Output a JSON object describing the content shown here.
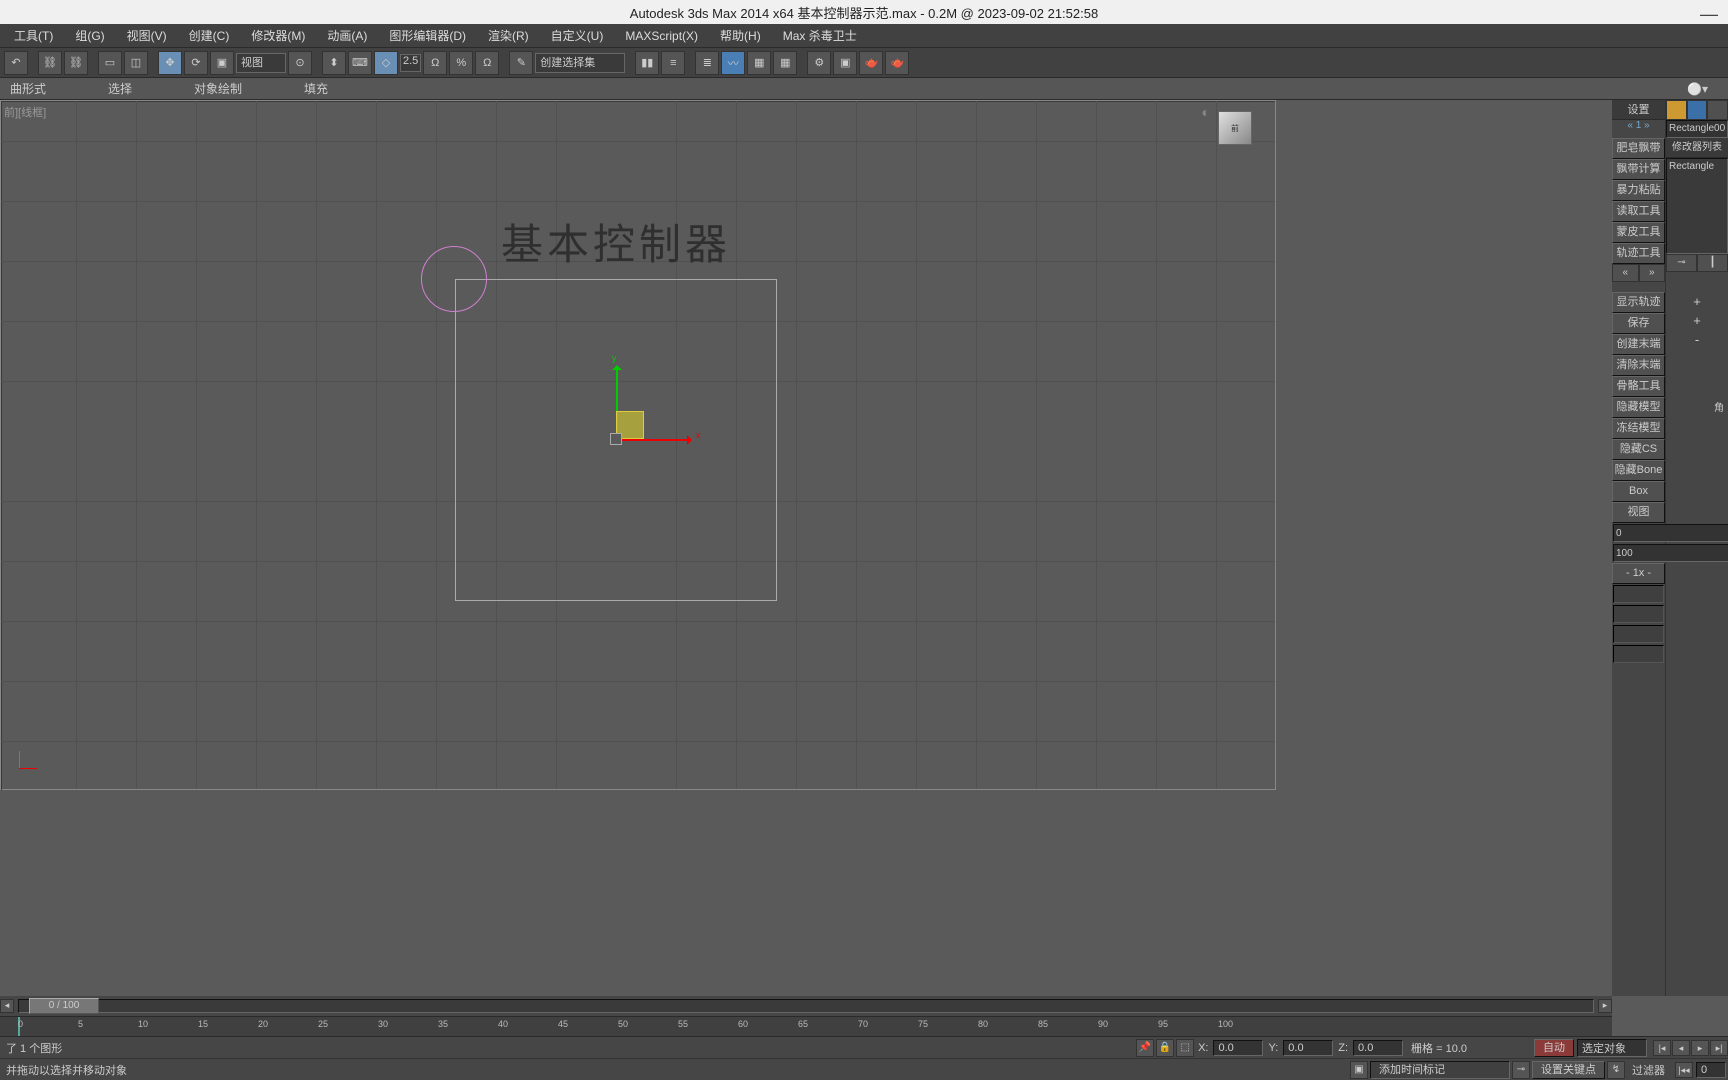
{
  "titlebar": {
    "text": "Autodesk 3ds Max  2014 x64      基本控制器示范.max - 0.2M @ 2023-09-02 21:52:58"
  },
  "menu": {
    "items": [
      "工具(T)",
      "组(G)",
      "视图(V)",
      "创建(C)",
      "修改器(M)",
      "动画(A)",
      "图形编辑器(D)",
      "渲染(R)",
      "自定义(U)",
      "MAXScript(X)",
      "帮助(H)",
      "Max 杀毒卫士"
    ]
  },
  "toolbar": {
    "view_dd": "视图",
    "spin_val": "2.5",
    "selset_dd": "创建选择集"
  },
  "ribbon": {
    "tabs": [
      "曲形式",
      "选择",
      "对象绘制",
      "填充"
    ]
  },
  "viewport": {
    "label": "前][线框]",
    "title_text": "基本控制器",
    "gizmo": {
      "x": "x",
      "y": "y"
    },
    "viewcube": "前"
  },
  "rightpanel": {
    "header1": "设置",
    "object_name": "Rectangle00",
    "link_label": "« 1 »",
    "mod_header": "修改器列表",
    "stack_item": "Rectangle",
    "col1_buttons": [
      "肥皂飘带",
      "飘带计算",
      "暴力粘贴",
      "读取工具",
      "蒙皮工具",
      "轨迹工具"
    ],
    "nav_prev": "«",
    "nav_next": "»",
    "col1_buttons2": [
      "显示轨迹",
      "保存",
      "创建末端",
      "清除末端",
      "骨骼工具",
      "隐藏模型",
      "冻结模型",
      "隐藏CS",
      "隐藏Bone",
      "Box",
      "视图"
    ],
    "spin0": "0",
    "spin100": "100",
    "rate_label": "- 1x -",
    "angle_label": "角"
  },
  "timeslider": {
    "value": "0 / 100"
  },
  "trackbar": {
    "ticks": [
      "0",
      "5",
      "10",
      "15",
      "20",
      "25",
      "30",
      "35",
      "40",
      "45",
      "50",
      "55",
      "60",
      "65",
      "70",
      "75",
      "80",
      "85",
      "90",
      "95",
      "100"
    ]
  },
  "status1": {
    "left_text": "了 1 个图形",
    "x_lbl": "X:",
    "x_val": "0.0",
    "y_lbl": "Y:",
    "y_val": "0.0",
    "z_lbl": "Z:",
    "z_val": "0.0",
    "grid_text": "栅格 = 10.0",
    "auto_btn": "自动",
    "filter_dd": "选定对象"
  },
  "status2": {
    "hint": "并拖动以选择并移动对象",
    "addtime_btn": "添加时间标记",
    "setkey_btn": "设置关键点",
    "filter_lbl": "过滤器"
  }
}
